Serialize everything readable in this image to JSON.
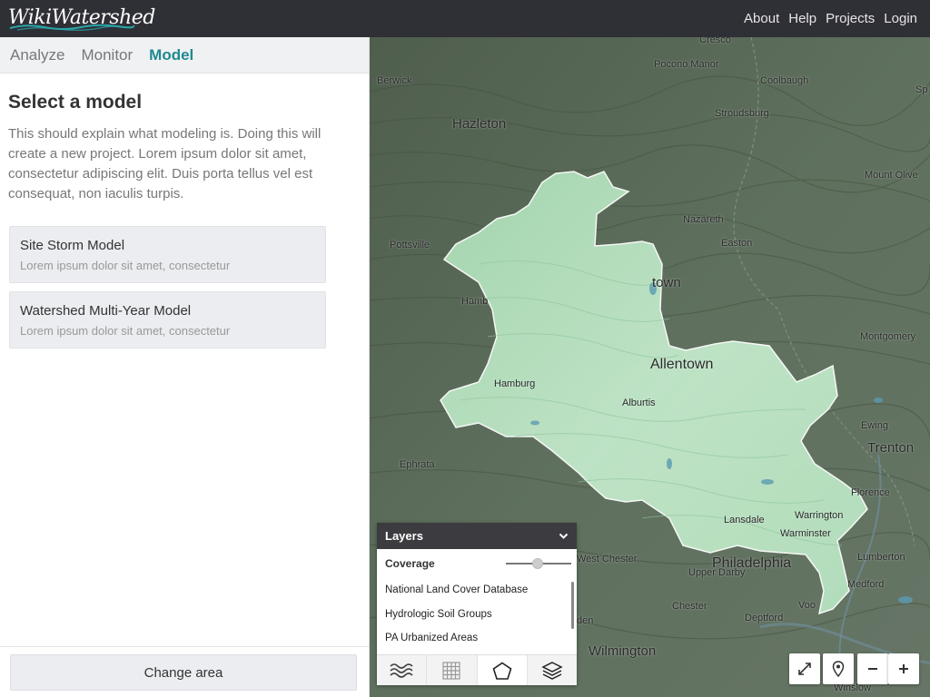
{
  "header": {
    "logo_text": "WikiWatershed",
    "nav": [
      "About",
      "Help",
      "Projects",
      "Login"
    ]
  },
  "sidebar": {
    "tabs": [
      {
        "label": "Analyze",
        "active": false
      },
      {
        "label": "Monitor",
        "active": false
      },
      {
        "label": "Model",
        "active": true
      }
    ],
    "title": "Select a model",
    "description": "This should explain what modeling is. Doing this will create a new project. Lorem ipsum dolor sit amet, consectetur adipiscing elit. Duis porta tellus vel est consequat, non iaculis turpis.",
    "models": [
      {
        "name": "Site Storm Model",
        "subtitle": "Lorem ipsum dolor sit amet, consectetur"
      },
      {
        "name": "Watershed Multi-Year Model",
        "subtitle": "Lorem ipsum dolor sit amet, consectetur"
      }
    ],
    "change_area_label": "Change area"
  },
  "map": {
    "places": [
      "Cresco",
      "Pocono Manor",
      "Berwick",
      "Coolbaugh",
      "Hazleton",
      "Stroudsburg",
      "Mount Olive",
      "Nazareth",
      "Pottsville",
      "Easton",
      "town",
      "Hamb",
      "Montgomery",
      "Allentown",
      "Hamburg",
      "Alburtis",
      "Ewing",
      "Trenton",
      "Ephrata",
      "Florence",
      "Warrington",
      "Lansdale",
      "Warminster",
      "Lumberton",
      "West Chester",
      "Philadelphia",
      "Upper Darby",
      "Medford",
      "Chester",
      "Deptford",
      "Voo",
      "den",
      "Wilmington",
      "Winslow",
      "Sp"
    ],
    "layers_panel": {
      "title": "Layers",
      "coverage_label": "Coverage",
      "coverage_opacity": 0.5,
      "items": [
        "National Land Cover Database",
        "Hydrologic Soil Groups",
        "PA Urbanized Areas"
      ],
      "icons": [
        "water-waves-icon",
        "grid-icon",
        "pentagon-icon",
        "stack-icon"
      ]
    },
    "controls": [
      "expand-icon",
      "location-pin-icon",
      "zoom-out-icon",
      "zoom-in-icon"
    ],
    "colors": {
      "terrain": "#5b6b5a",
      "watershed": "#bfe6c6",
      "header": "#2f2f36",
      "accent": "#1f8a8f"
    }
  }
}
